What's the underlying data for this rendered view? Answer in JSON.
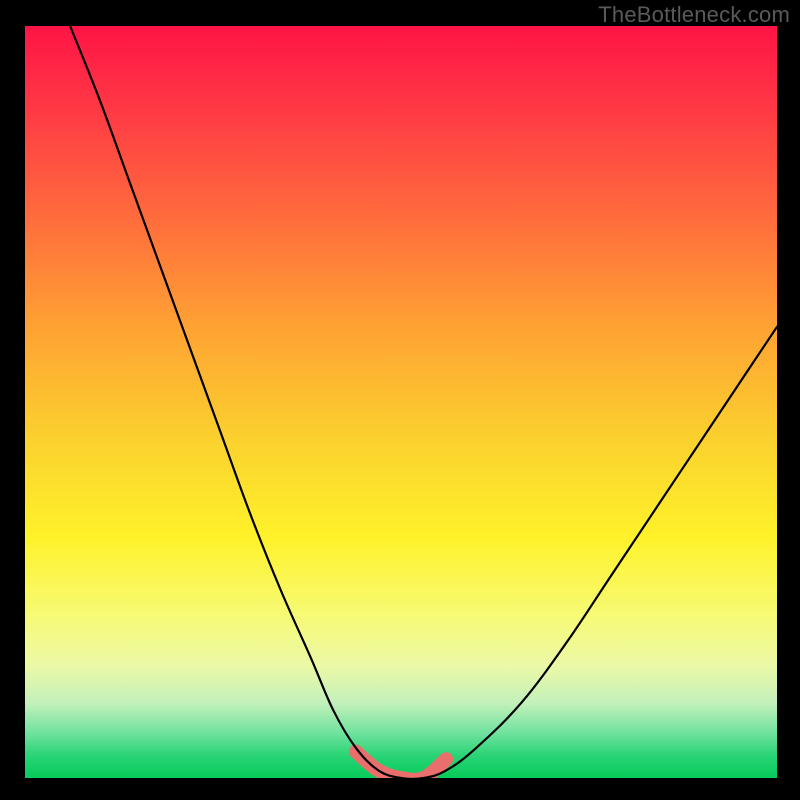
{
  "watermark": "TheBottleneck.com",
  "chart_data": {
    "type": "line",
    "title": "",
    "xlabel": "",
    "ylabel": "",
    "xlim": [
      0,
      100
    ],
    "ylim": [
      0,
      100
    ],
    "grid": false,
    "series": [
      {
        "name": "bottleneck-curve",
        "x": [
          6,
          10,
          14,
          18,
          22,
          26,
          30,
          34,
          38,
          41,
          44,
          47,
          50,
          53,
          56,
          60,
          66,
          72,
          78,
          84,
          90,
          96,
          100
        ],
        "values": [
          100,
          90,
          79,
          68,
          57,
          46,
          35,
          25,
          16,
          9,
          4,
          1,
          0,
          0,
          1,
          4,
          10,
          18,
          27,
          36,
          45,
          54,
          60
        ]
      },
      {
        "name": "sweet-spot-highlight",
        "x": [
          44,
          47,
          50,
          53,
          56
        ],
        "values": [
          3.5,
          1,
          0,
          0,
          2.5
        ]
      }
    ],
    "colors": {
      "gradient_top": "#ff1445",
      "gradient_bottom": "#06cb59",
      "curve": "#000000",
      "highlight": "#ea6f6c",
      "frame": "#000000"
    }
  }
}
